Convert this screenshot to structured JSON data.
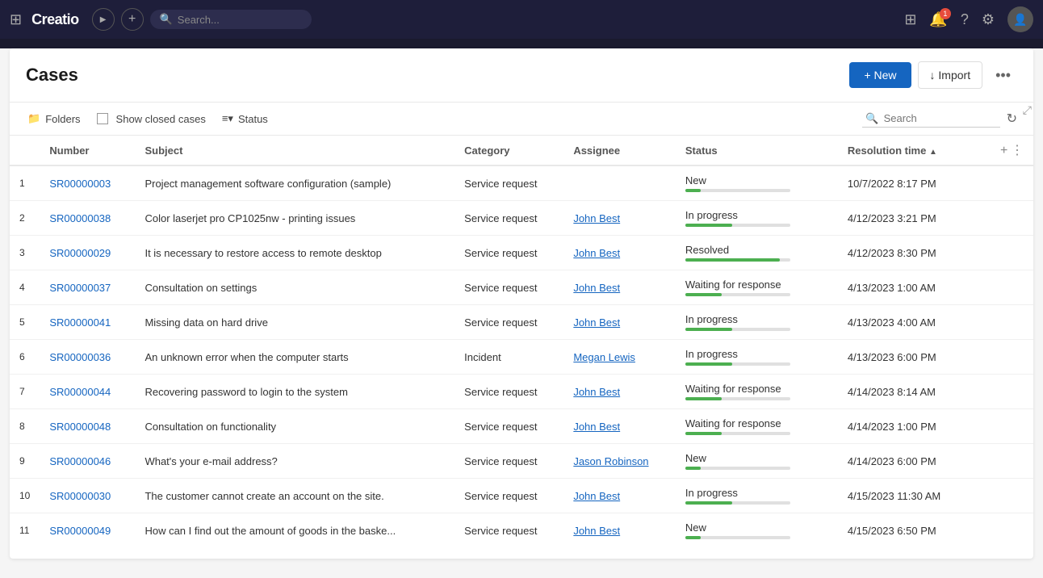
{
  "topnav": {
    "logo": "Creatio",
    "search_placeholder": "Search...",
    "notification_count": "1"
  },
  "header": {
    "title": "Cases",
    "new_button": "+ New",
    "import_button": "↓ Import",
    "more_icon": "•••"
  },
  "toolbar": {
    "folders_label": "Folders",
    "show_closed_label": "Show closed cases",
    "status_label": "Status",
    "search_placeholder": "Search",
    "refresh_icon": "↻"
  },
  "table": {
    "columns": [
      "Number",
      "Subject",
      "Category",
      "Assignee",
      "Status",
      "Resolution time"
    ],
    "rows": [
      {
        "index": 1,
        "number": "SR00000003",
        "subject": "Project management software configuration (sample)",
        "category": "Service request",
        "assignee": "",
        "status": "New",
        "status_pct": 15,
        "resolution_time": "10/7/2022 8:17 PM"
      },
      {
        "index": 2,
        "number": "SR00000038",
        "subject": "Color laserjet pro CP1025nw - printing issues",
        "category": "Service request",
        "assignee": "John Best",
        "status": "In progress",
        "status_pct": 45,
        "resolution_time": "4/12/2023 3:21 PM"
      },
      {
        "index": 3,
        "number": "SR00000029",
        "subject": "It is necessary to restore access to remote desktop",
        "category": "Service request",
        "assignee": "John Best",
        "status": "Resolved",
        "status_pct": 90,
        "resolution_time": "4/12/2023 8:30 PM"
      },
      {
        "index": 4,
        "number": "SR00000037",
        "subject": "Consultation on settings",
        "category": "Service request",
        "assignee": "John Best",
        "status": "Waiting for response",
        "status_pct": 35,
        "resolution_time": "4/13/2023 1:00 AM"
      },
      {
        "index": 5,
        "number": "SR00000041",
        "subject": "Missing data on hard drive",
        "category": "Service request",
        "assignee": "John Best",
        "status": "In progress",
        "status_pct": 45,
        "resolution_time": "4/13/2023 4:00 AM"
      },
      {
        "index": 6,
        "number": "SR00000036",
        "subject": "An unknown error when the computer starts",
        "category": "Incident",
        "assignee": "Megan Lewis",
        "status": "In progress",
        "status_pct": 45,
        "resolution_time": "4/13/2023 6:00 PM"
      },
      {
        "index": 7,
        "number": "SR00000044",
        "subject": "Recovering password to login to the system",
        "category": "Service request",
        "assignee": "John Best",
        "status": "Waiting for response",
        "status_pct": 35,
        "resolution_time": "4/14/2023 8:14 AM"
      },
      {
        "index": 8,
        "number": "SR00000048",
        "subject": "Consultation on functionality",
        "category": "Service request",
        "assignee": "John Best",
        "status": "Waiting for response",
        "status_pct": 35,
        "resolution_time": "4/14/2023 1:00 PM"
      },
      {
        "index": 9,
        "number": "SR00000046",
        "subject": "What's your e-mail address?",
        "category": "Service request",
        "assignee": "Jason Robinson",
        "status": "New",
        "status_pct": 15,
        "resolution_time": "4/14/2023 6:00 PM"
      },
      {
        "index": 10,
        "number": "SR00000030",
        "subject": "The customer cannot create an account on the site.",
        "category": "Service request",
        "assignee": "John Best",
        "status": "In progress",
        "status_pct": 45,
        "resolution_time": "4/15/2023 11:30 AM"
      },
      {
        "index": 11,
        "number": "SR00000049",
        "subject": "How can I find out the amount of goods in the baske...",
        "category": "Service request",
        "assignee": "John Best",
        "status": "New",
        "status_pct": 15,
        "resolution_time": "4/15/2023 6:50 PM"
      }
    ]
  }
}
